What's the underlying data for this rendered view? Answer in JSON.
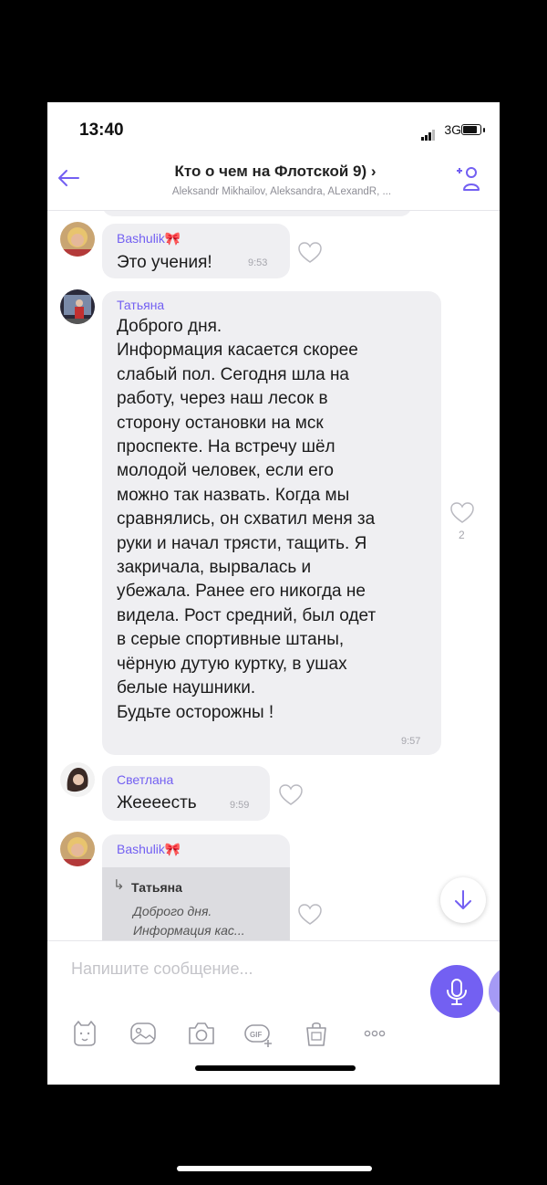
{
  "status_bar": {
    "time": "13:40",
    "network": "3G"
  },
  "header": {
    "title": "Кто о чем на Флотской 9) ›",
    "subtitle": "Aleksandr Mikhailov, Aleksandra, ALexandR, ..."
  },
  "colors": {
    "accent": "#7360f2",
    "bubble": "#efeff2",
    "meta": "#a6a6ad"
  },
  "messages": [
    {
      "sender": "Bashulik🎀",
      "text": "Это учения!",
      "time": "9:53",
      "likes": ""
    },
    {
      "sender": "Татьяна",
      "text": "Доброго дня.\nИнформация касается скорее\nслабый пол. Сегодня шла на\nработу, через наш лесок в\nсторону остановки на мск\nпроспекте. На встречу шёл\nмолодой человек, если его\nможно так назвать. Когда мы\nсравнялись, он схватил меня за\nруки и начал трясти, тащить. Я\nзакричала, вырвалась и\nубежала. Ранее его никогда не\nвидела. Рост средний, был одет\nв серые спортивные штаны,\nчёрную дутую куртку, в ушах\nбелые наушники.\nБудьте осторожны !",
      "time": "9:57",
      "likes": "2"
    },
    {
      "sender": "Светлана",
      "text": "Жеееесть",
      "time": "9:59",
      "likes": ""
    },
    {
      "sender": "Bashulik🎀",
      "reply": {
        "arrow": "↳",
        "name": "Татьяна",
        "text": "Доброго дня.\nИнформация кас..."
      }
    }
  ],
  "composer": {
    "placeholder": "Напишите сообщение..."
  },
  "icons": [
    "back-arrow-icon",
    "add-member-icon",
    "heart-icon",
    "scroll-down-icon",
    "sticker-icon",
    "gallery-icon",
    "camera-icon",
    "gif-icon",
    "bag-icon",
    "more-icon",
    "microphone-icon"
  ]
}
